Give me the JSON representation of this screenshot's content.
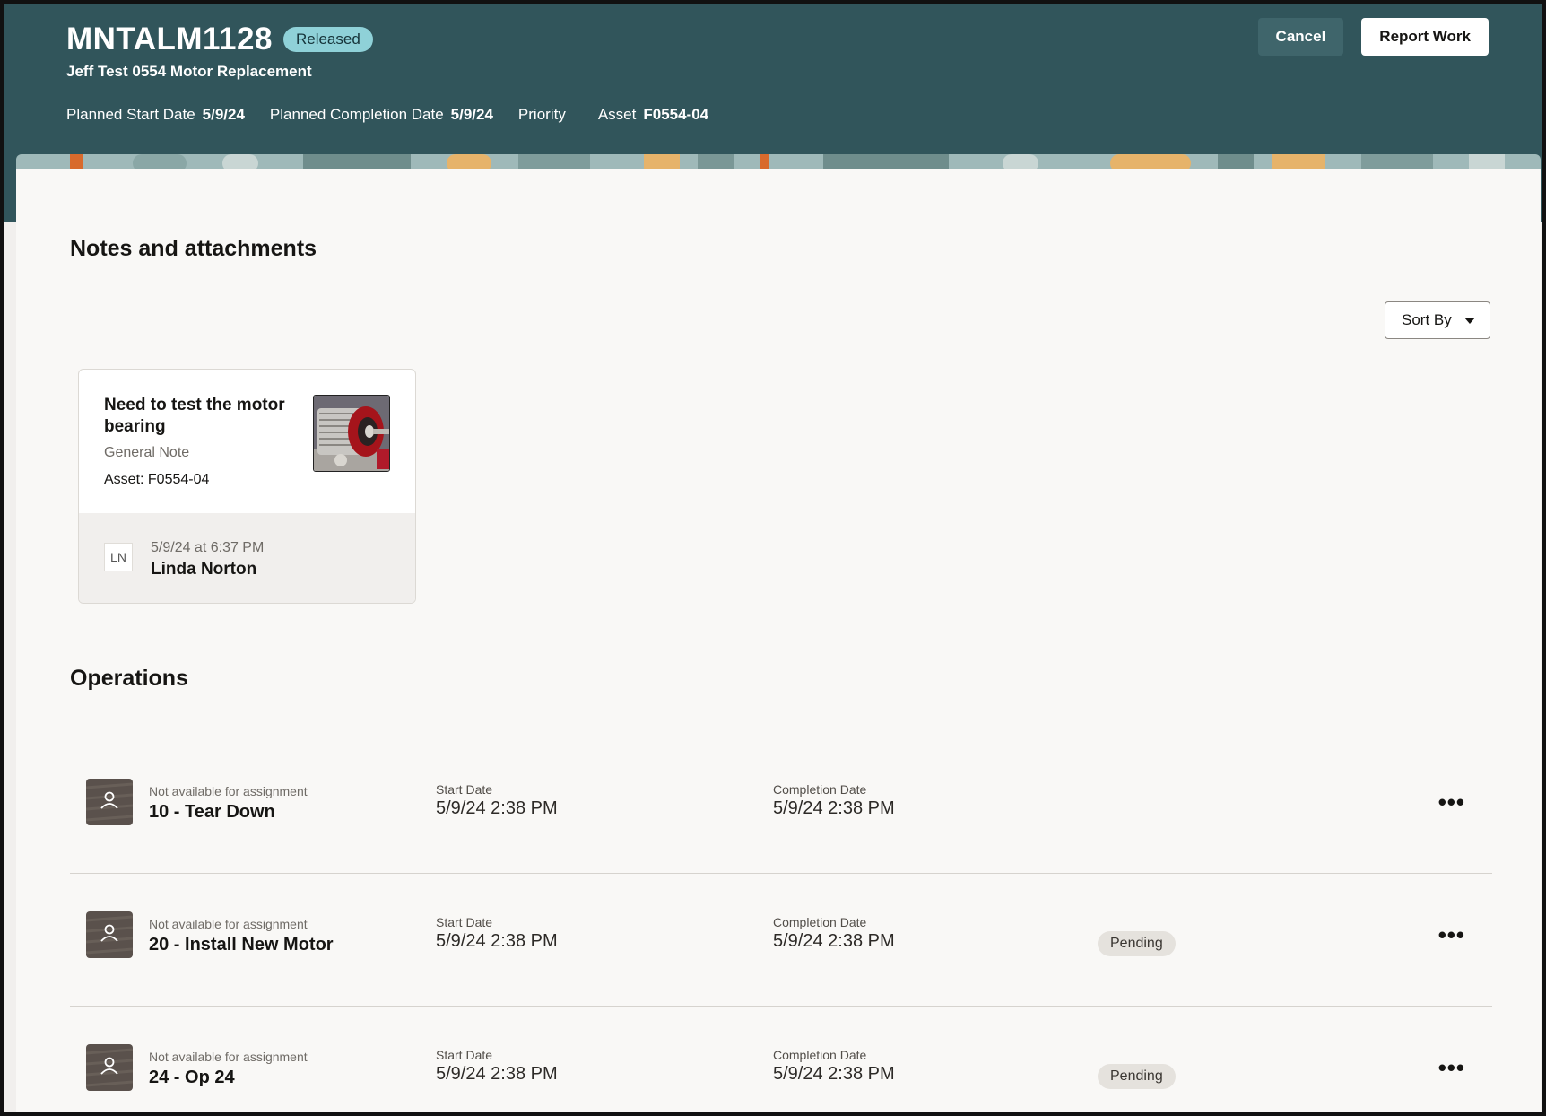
{
  "header": {
    "title": "MNTALM1128",
    "status": "Released",
    "subtitle": "Jeff Test 0554 Motor Replacement",
    "meta": [
      {
        "label": "Planned Start Date",
        "value": "5/9/24"
      },
      {
        "label": "Planned Completion Date",
        "value": "5/9/24"
      },
      {
        "label": "Priority",
        "value": ""
      },
      {
        "label": "Asset",
        "value": "F0554-04"
      }
    ],
    "cancel_label": "Cancel",
    "report_label": "Report Work"
  },
  "notes": {
    "section_title": "Notes and attachments",
    "sort_label": "Sort By",
    "card": {
      "title": "Need to test the motor bearing",
      "type": "General Note",
      "asset": "Asset: F0554-04",
      "initials": "LN",
      "date": "5/9/24 at 6:37 PM",
      "author": "Linda Norton"
    }
  },
  "operations": {
    "section_title": "Operations",
    "start_label": "Start Date",
    "completion_label": "Completion Date",
    "rows": [
      {
        "availability": "Not available for assignment",
        "name": "10 - Tear Down",
        "start": "5/9/24 2:38 PM",
        "completion": "5/9/24 2:38 PM",
        "status": ""
      },
      {
        "availability": "Not available for assignment",
        "name": "20 - Install New Motor",
        "start": "5/9/24 2:38 PM",
        "completion": "5/9/24 2:38 PM",
        "status": "Pending"
      },
      {
        "availability": "Not available for assignment",
        "name": "24 - Op 24",
        "start": "5/9/24 2:38 PM",
        "completion": "5/9/24 2:38 PM",
        "status": "Pending"
      }
    ],
    "more_label": "•••"
  },
  "colors": {
    "header_bg": "#31555b",
    "badge_bg": "#8fd1d8",
    "panel_bg": "#f9f8f6"
  }
}
